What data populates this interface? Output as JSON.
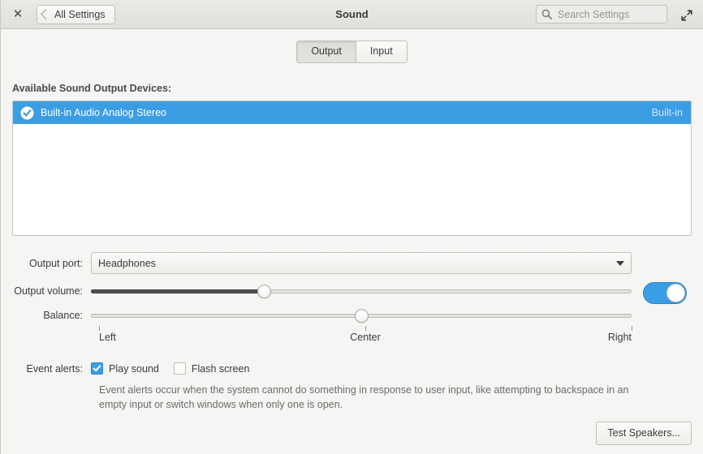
{
  "titlebar": {
    "close_label": "✕",
    "back_label": "All Settings",
    "title": "Sound",
    "search_placeholder": "Search Settings",
    "search_value": "",
    "search_icon": "search-icon",
    "maximize_icon": "maximize-icon"
  },
  "tabs": [
    {
      "label": "Output",
      "active": true
    },
    {
      "label": "Input",
      "active": false
    }
  ],
  "devices": {
    "section_label": "Available Sound Output Devices:",
    "rows": [
      {
        "name": "Built-in Audio Analog Stereo",
        "badge": "Built-in",
        "selected": true,
        "checked": true
      }
    ]
  },
  "output_port": {
    "label": "Output port:",
    "value": "Headphones"
  },
  "output_volume": {
    "label": "Output volume:",
    "percent": 32,
    "muted": false,
    "toggle_on": true
  },
  "balance": {
    "label": "Balance:",
    "percent": 50,
    "scale": [
      {
        "label": "Left",
        "percent": 0
      },
      {
        "label": "Center",
        "percent": 50
      },
      {
        "label": "Right",
        "percent": 100
      }
    ]
  },
  "event_alerts": {
    "label": "Event alerts:",
    "options": [
      {
        "label": "Play sound",
        "checked": true
      },
      {
        "label": "Flash screen",
        "checked": false
      }
    ],
    "description": "Event alerts occur when the system cannot do something in response to user input, like attempting to backspace in an empty input or switch windows when only one is open."
  },
  "footer": {
    "test_speakers_label": "Test Speakers..."
  },
  "colors": {
    "accent": "#3b9ee5",
    "window_bg": "#f5f5f4",
    "text": "#3b3b3b"
  }
}
